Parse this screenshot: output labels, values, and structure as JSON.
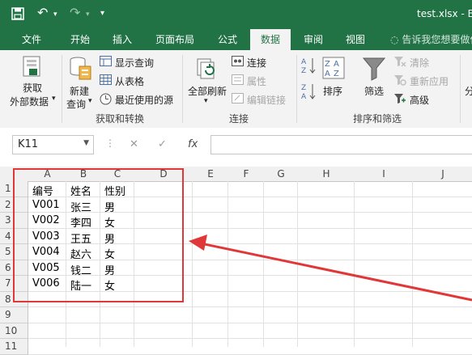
{
  "app": {
    "window_title": "test.xlsx - Ex",
    "qat_undo": "↶",
    "qat_redo": "↷",
    "qat_more": "▾"
  },
  "tabs": [
    {
      "label": "文件",
      "active": false
    },
    {
      "label": "开始",
      "active": false
    },
    {
      "label": "插入",
      "active": false
    },
    {
      "label": "页面布局",
      "active": false
    },
    {
      "label": "公式",
      "active": false
    },
    {
      "label": "数据",
      "active": true
    },
    {
      "label": "审阅",
      "active": false
    },
    {
      "label": "视图",
      "active": false
    }
  ],
  "tellme": "告诉我您想要做什么",
  "ribbon": {
    "get_external_line1": "获取",
    "get_external_line2": "外部数据",
    "new_query_line1": "新建",
    "new_query_line2": "查询",
    "show_queries": "显示查询",
    "from_table": "从表格",
    "recent_sources": "最近使用的源",
    "refresh_all": "全部刷新",
    "connections": "连接",
    "properties": "属性",
    "edit_links": "编辑链接",
    "sort": "排序",
    "filter": "筛选",
    "clear": "清除",
    "reapply": "重新应用",
    "advanced": "高级",
    "group_get_transform": "获取和转换",
    "group_connections": "连接",
    "group_sort_filter": "排序和筛选",
    "next_group_peek": "分"
  },
  "formula_bar": {
    "name_box": "K11",
    "cancel": "✕",
    "enter": "✓",
    "fx": "fx",
    "formula": ""
  },
  "sheet": {
    "columns": [
      "A",
      "B",
      "C",
      "D",
      "E",
      "F",
      "G",
      "H",
      "I",
      "J"
    ],
    "row_numbers": [
      "1",
      "2",
      "3",
      "4",
      "5",
      "6",
      "7",
      "8",
      "9",
      "10",
      "11"
    ],
    "rows": [
      [
        "编号",
        "姓名",
        "性别"
      ],
      [
        "V001",
        "张三",
        "男"
      ],
      [
        "V002",
        "李四",
        "女"
      ],
      [
        "V003",
        "王五",
        "男"
      ],
      [
        "V004",
        "赵六",
        "女"
      ],
      [
        "V005",
        "钱二",
        "男"
      ],
      [
        "V006",
        "陆一",
        "女"
      ]
    ]
  },
  "colors": {
    "excel_green": "#217346",
    "annotation_red": "#e03838"
  }
}
